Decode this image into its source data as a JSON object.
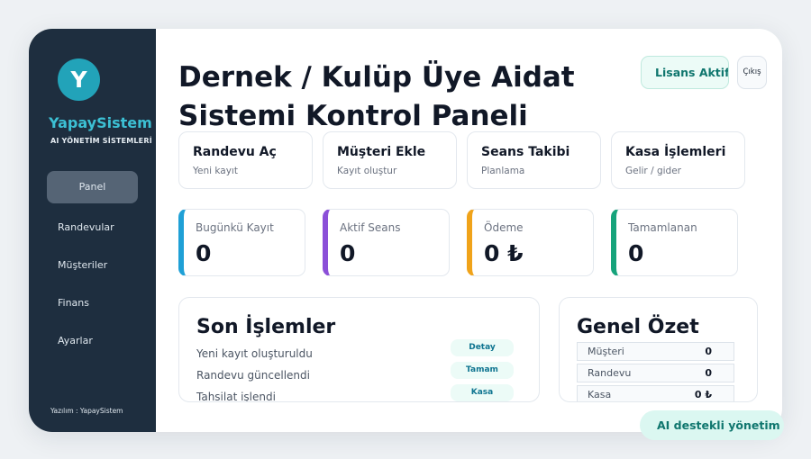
{
  "sidebar": {
    "logo_letter": "Y",
    "brand_name": "YapaySistem",
    "brand_sub": "AI YÖNETİM SİSTEMLERİ",
    "nav": [
      {
        "label": "Panel",
        "active": true
      },
      {
        "label": "Randevular"
      },
      {
        "label": "Müşteriler"
      },
      {
        "label": "Finans"
      },
      {
        "label": "Ayarlar"
      }
    ],
    "footer": "Yazılım : YapaySistem"
  },
  "header": {
    "title": "Dernek / Kulüp Üye Aidat Sistemi Kontrol Paneli",
    "license_label": "Lisans Aktif",
    "logout_label": "Çıkış"
  },
  "actions": [
    {
      "title": "Randevu Aç",
      "subtitle": "Yeni kayıt"
    },
    {
      "title": "Müşteri Ekle",
      "subtitle": "Kayıt oluştur"
    },
    {
      "title": "Seans Takibi",
      "subtitle": "Planlama"
    },
    {
      "title": "Kasa İşlemleri",
      "subtitle": "Gelir / gider"
    }
  ],
  "stats": [
    {
      "label": "Bugünkü Kayıt",
      "value": "0",
      "color": "#1fa0d6"
    },
    {
      "label": "Aktif Seans",
      "value": "0",
      "color": "#8b4fd8"
    },
    {
      "label": "Ödeme",
      "value": "0 ₺",
      "color": "#f0a31a"
    },
    {
      "label": "Tamamlanan",
      "value": "0",
      "color": "#16a37b"
    }
  ],
  "recent": {
    "title": "Son İşlemler",
    "items": [
      {
        "text": "Yeni kayıt oluşturuldu",
        "tag": "Detay"
      },
      {
        "text": "Randevu güncellendi",
        "tag": "Tamam"
      },
      {
        "text": "Tahsilat işlendi",
        "tag": "Kasa"
      }
    ]
  },
  "summary": {
    "title": "Genel Özet",
    "rows": [
      {
        "label": "Müşteri",
        "value": "0"
      },
      {
        "label": "Randevu",
        "value": "0"
      },
      {
        "label": "Kasa",
        "value": "0 ₺"
      }
    ]
  },
  "ai_badge": "AI destekli yönetim"
}
